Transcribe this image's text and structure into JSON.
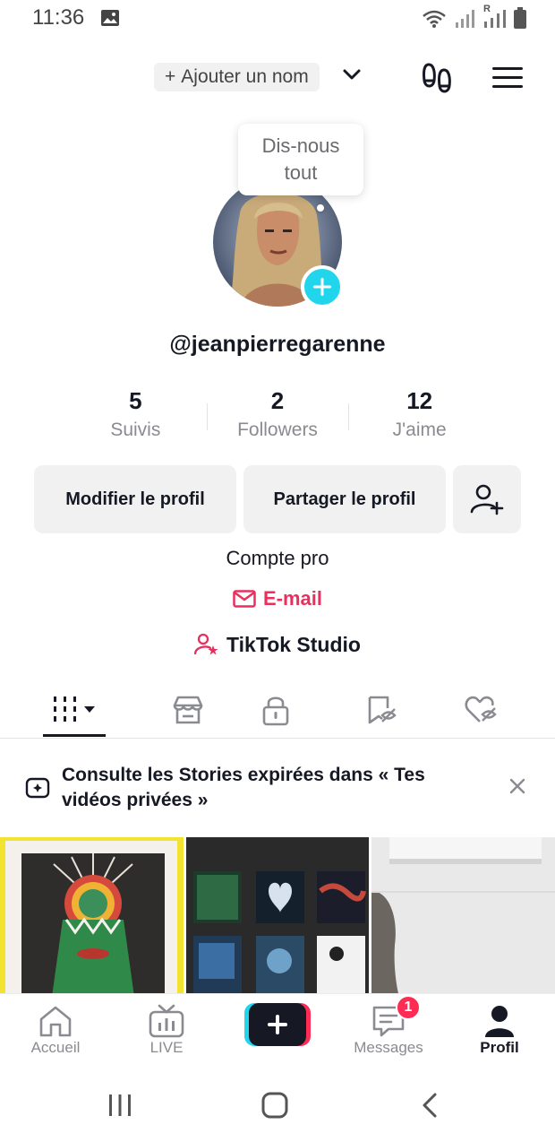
{
  "status_bar": {
    "time": "11:36",
    "carrier_indicator": "R"
  },
  "header": {
    "add_name_label": "Ajouter un nom",
    "add_name_prefix": "+"
  },
  "tooltip": {
    "line1": "Dis-nous",
    "line2": "tout"
  },
  "profile": {
    "username": "@jeanpierregarenne",
    "account_type": "Compte pro",
    "email_label": "E-mail",
    "studio_label": "TikTok Studio"
  },
  "stats": [
    {
      "value": "5",
      "label": "Suivis"
    },
    {
      "value": "2",
      "label": "Followers"
    },
    {
      "value": "12",
      "label": "J'aime"
    }
  ],
  "actions": {
    "edit_profile": "Modifier le profil",
    "share_profile": "Partager le profil"
  },
  "banner": {
    "text": "Consulte les Stories expirées dans « Tes vidéos privées »"
  },
  "bottom_nav": {
    "items": [
      {
        "label": "Accueil"
      },
      {
        "label": "LIVE"
      },
      {
        "label": "Messages",
        "badge": "1"
      },
      {
        "label": "Profil"
      }
    ]
  },
  "colors": {
    "accent_pink": "#e8305e",
    "badge_red": "#fe2c55",
    "cyan": "#20d5ec",
    "text_dark": "#161823",
    "text_gray": "#8a8b91"
  }
}
